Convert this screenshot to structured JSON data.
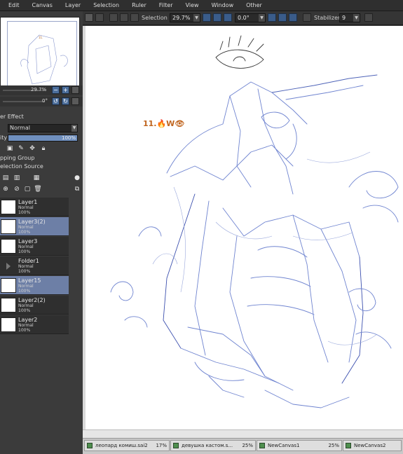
{
  "menu": [
    "Edit",
    "Canvas",
    "Layer",
    "Selection",
    "Ruler",
    "Filter",
    "View",
    "Window",
    "Other"
  ],
  "toolbar": {
    "selection_label": "Selection",
    "zoom_value": "29.7%",
    "rotation_value": "0.0°",
    "stabilizer_label": "Stabilizer",
    "stabilizer_value": "9"
  },
  "navigator": {
    "zoom": "29.7%",
    "angle": "0°"
  },
  "layer_props": {
    "effect_label": "er Effect",
    "blend_mode": "Normal",
    "opacity_label": "ity",
    "opacity_value": "100%",
    "clipping_label": "pping Group",
    "selection_source_label": "election Source"
  },
  "layers": [
    {
      "name": "Layer1",
      "mode": "Normal",
      "opacity": "100%",
      "selected": false
    },
    {
      "name": "Layer3(2)",
      "mode": "Normal",
      "opacity": "100%",
      "selected": true
    },
    {
      "name": "Layer3",
      "mode": "Normal",
      "opacity": "100%",
      "selected": false
    },
    {
      "name": "Folder1",
      "mode": "Normal",
      "opacity": "100%",
      "selected": false
    },
    {
      "name": "Layer15",
      "mode": "Normal",
      "opacity": "100%",
      "selected": true
    },
    {
      "name": "Layer2(2)",
      "mode": "Normal",
      "opacity": "100%",
      "selected": false
    },
    {
      "name": "Layer2",
      "mode": "Normal",
      "opacity": "100%",
      "selected": false
    }
  ],
  "canvas": {
    "watermark": "11.🔥W👁"
  },
  "doc_tabs": [
    {
      "name": "леопард комиш.sai2",
      "zoom": "17%"
    },
    {
      "name": "девушка кастом.s...",
      "zoom": "25%"
    },
    {
      "name": "NewCanvas1",
      "zoom": "25%"
    },
    {
      "name": "NewCanvas2",
      "zoom": ""
    }
  ],
  "colors": {
    "accent": "#6d7fa6",
    "sketch": "#5a6fc4"
  }
}
